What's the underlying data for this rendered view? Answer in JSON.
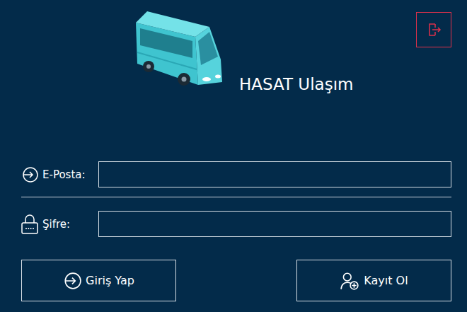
{
  "window": {
    "title": "HASAT Ulaşım"
  },
  "fields": [
    {
      "label": "E-Posta:",
      "value": "",
      "kind": "email"
    },
    {
      "label": "Şifre:",
      "value": "",
      "kind": "password"
    }
  ],
  "buttons": [
    {
      "label": "Giriş Yap",
      "kind": "login"
    },
    {
      "label": "Kayıt Ol",
      "kind": "register"
    }
  ]
}
